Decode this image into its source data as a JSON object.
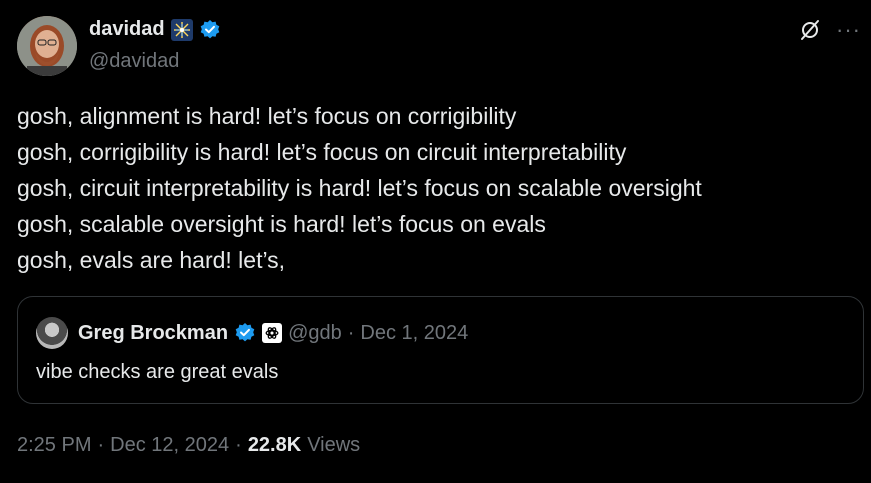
{
  "author": {
    "display_name": "davidad",
    "handle": "@davidad",
    "org_badge_icon": "sparkle-burst-icon",
    "verified_icon": "verified-badge-icon"
  },
  "top_icons": [
    "grok-icon",
    "more-icon"
  ],
  "more_label": "···",
  "tweet": {
    "lines": [
      "gosh, alignment is hard! let’s focus on corrigibility",
      "gosh, corrigibility is hard! let’s focus on circuit interpretability",
      "gosh, circuit interpretability is hard! let’s focus on scalable oversight",
      "gosh, scalable oversight is hard! let’s focus on evals",
      "gosh, evals are hard! let’s,"
    ]
  },
  "quoted": {
    "display_name": "Greg Brockman",
    "handle": "@gdb",
    "separator": "·",
    "date": "Dec 1, 2024",
    "text": "vibe checks are great evals",
    "affiliation_icon": "openai-logo-icon"
  },
  "meta": {
    "time": "2:25 PM",
    "separator": "·",
    "date": "Dec 12, 2024",
    "views_count": "22.8K",
    "views_label": "Views"
  },
  "colors": {
    "background": "#000000",
    "text_primary": "#e7e9ea",
    "text_secondary": "#71767b",
    "border": "#2f3336",
    "verified_blue": "#1d9bf0"
  }
}
